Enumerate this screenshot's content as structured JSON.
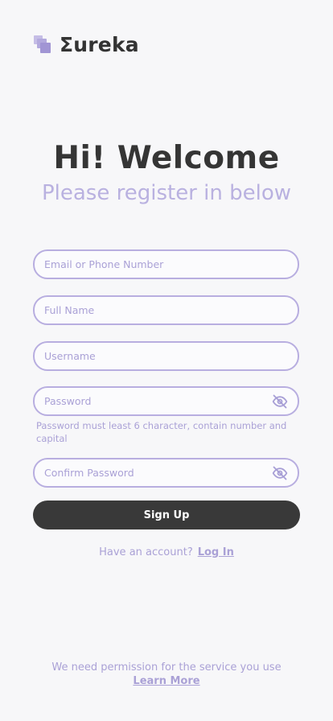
{
  "brand": {
    "name": "Σureka",
    "icon": "stacked-squares-logo-icon"
  },
  "heading": {
    "title": "Hi! Welcome",
    "subtitle": "Please register in below"
  },
  "form": {
    "email_placeholder": "Email or Phone Number",
    "fullname_placeholder": "Full Name",
    "username_placeholder": "Username",
    "password_placeholder": "Password",
    "password_hint": "Password must least 6 character,  contain number and capital",
    "confirm_password_placeholder": "Confirm Password",
    "password_toggle_icon": "eye-off-icon",
    "signup_label": "Sign Up"
  },
  "account": {
    "prompt": "Have an account?",
    "login_label": "Log In"
  },
  "footer": {
    "permission_text": "We need permission for the service you use",
    "learn_more_label": "Learn More"
  },
  "colors": {
    "accent": "#b8aee0",
    "dark": "#393939",
    "background": "#f7f7f9"
  }
}
